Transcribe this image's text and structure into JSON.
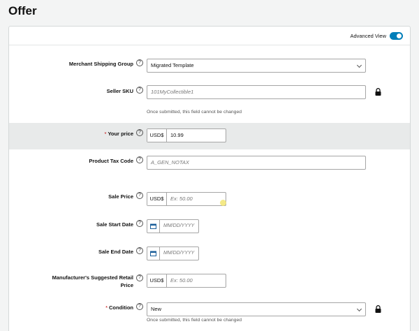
{
  "page": {
    "title": "Offer"
  },
  "header": {
    "advanced_view_label": "Advanced View",
    "advanced_view_on": true
  },
  "fields": {
    "shipping_group": {
      "label": "Merchant Shipping Group",
      "value": "Migrated Template"
    },
    "seller_sku": {
      "label": "Seller SKU",
      "placeholder": "101MyCollectible1",
      "note": "Once submitted, this field cannot be changed"
    },
    "your_price": {
      "required_mark": "*",
      "label": "Your price",
      "currency": "USD$",
      "value": "10.99"
    },
    "tax_code": {
      "label": "Product Tax Code",
      "placeholder": "A_GEN_NOTAX"
    },
    "sale_price": {
      "label": "Sale Price",
      "currency": "USD$",
      "placeholder": "Ex: 50.00"
    },
    "sale_start": {
      "label": "Sale Start Date",
      "placeholder": "MM/DD/YYYY"
    },
    "sale_end": {
      "label": "Sale End Date",
      "placeholder": "MM/DD/YYYY"
    },
    "msrp": {
      "label_line1": "Manufacturer's Suggested Retail",
      "label_line2": "Price",
      "currency": "USD$",
      "placeholder": "Ex: 50.00"
    },
    "condition": {
      "required_mark": "*",
      "label": "Condition",
      "value": "New",
      "note": "Once submitted, this field cannot be changed"
    }
  },
  "icons": {
    "help": "question-circle-icon",
    "lock": "lock-icon",
    "calendar": "calendar-icon",
    "chevron": "chevron-down-icon"
  },
  "colors": {
    "accent": "#007eb9",
    "required": "#c40000",
    "highlight_row": "#e8eaea"
  }
}
